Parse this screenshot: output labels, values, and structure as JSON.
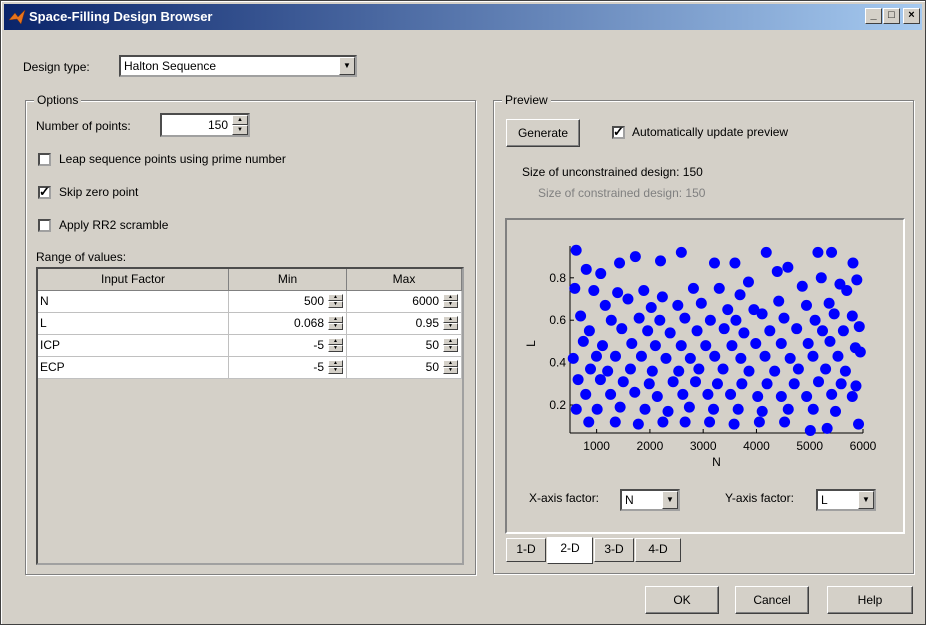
{
  "window": {
    "title": "Space-Filling Design Browser"
  },
  "design_type": {
    "label": "Design type:",
    "value": "Halton Sequence"
  },
  "options": {
    "legend": "Options",
    "num_points_label": "Number of points:",
    "num_points_value": "150",
    "leap_label": "Leap sequence points using prime number",
    "leap_checked": false,
    "skip_zero_label": "Skip zero point",
    "skip_zero_checked": true,
    "rr2_label": "Apply RR2 scramble",
    "rr2_checked": false,
    "range_label": "Range of values:",
    "table": {
      "columns": [
        "Input Factor",
        "Min",
        "Max"
      ],
      "rows": [
        {
          "factor": "N",
          "min": "500",
          "max": "6000"
        },
        {
          "factor": "L",
          "min": "0.068",
          "max": "0.95"
        },
        {
          "factor": "ICP",
          "min": "-5",
          "max": "50"
        },
        {
          "factor": "ECP",
          "min": "-5",
          "max": "50"
        }
      ]
    }
  },
  "preview": {
    "legend": "Preview",
    "generate_label": "Generate",
    "auto_update_label": "Automatically update preview",
    "auto_update_checked": true,
    "unconstrained_text": "Size of unconstrained design: 150",
    "constrained_text": "Size of constrained design: 150",
    "x_factor_label": "X-axis factor:",
    "x_factor_value": "N",
    "y_factor_label": "Y-axis factor:",
    "y_factor_value": "L",
    "tabs": [
      "1-D",
      "2-D",
      "3-D",
      "4-D"
    ],
    "active_tab": "2-D"
  },
  "buttons": {
    "ok": "OK",
    "cancel": "Cancel",
    "help": "Help"
  },
  "colors": {
    "titlebar": "#0a246a",
    "points": "#0000ff",
    "face": "#d4d0c8"
  },
  "chart_data": {
    "type": "scatter",
    "xlabel": "N",
    "ylabel": "L",
    "xlim": [
      500,
      6000
    ],
    "ylim": [
      0.068,
      0.95
    ],
    "xticks": [
      1000,
      2000,
      3000,
      4000,
      5000,
      6000
    ],
    "yticks": [
      0.2,
      0.4,
      0.6,
      0.8
    ],
    "series": [
      {
        "points": [
          [
            616,
            0.93
          ],
          [
            1077,
            0.82
          ],
          [
            805,
            0.84
          ],
          [
            1430,
            0.87
          ],
          [
            1727,
            0.9
          ],
          [
            2199,
            0.88
          ],
          [
            2590,
            0.92
          ],
          [
            3212,
            0.87
          ],
          [
            3596,
            0.87
          ],
          [
            4184,
            0.92
          ],
          [
            4590,
            0.85
          ],
          [
            5154,
            0.92
          ],
          [
            5410,
            0.92
          ],
          [
            5812,
            0.87
          ],
          [
            590,
            0.75
          ],
          [
            947,
            0.74
          ],
          [
            1394,
            0.73
          ],
          [
            1885,
            0.74
          ],
          [
            2234,
            0.71
          ],
          [
            2817,
            0.75
          ],
          [
            3302,
            0.75
          ],
          [
            3692,
            0.72
          ],
          [
            3850,
            0.78
          ],
          [
            4391,
            0.83
          ],
          [
            4860,
            0.76
          ],
          [
            5217,
            0.8
          ],
          [
            5567,
            0.77
          ],
          [
            5884,
            0.79
          ],
          [
            1162,
            0.67
          ],
          [
            1588,
            0.7
          ],
          [
            2025,
            0.66
          ],
          [
            2524,
            0.67
          ],
          [
            2965,
            0.68
          ],
          [
            3461,
            0.65
          ],
          [
            3952,
            0.65
          ],
          [
            4418,
            0.69
          ],
          [
            4939,
            0.67
          ],
          [
            5364,
            0.68
          ],
          [
            5695,
            0.74
          ],
          [
            699,
            0.62
          ],
          [
            1275,
            0.6
          ],
          [
            1798,
            0.61
          ],
          [
            2186,
            0.6
          ],
          [
            2656,
            0.61
          ],
          [
            3135,
            0.6
          ],
          [
            3615,
            0.6
          ],
          [
            4106,
            0.63
          ],
          [
            4517,
            0.61
          ],
          [
            5101,
            0.6
          ],
          [
            5459,
            0.63
          ],
          [
            5799,
            0.62
          ],
          [
            864,
            0.55
          ],
          [
            1472,
            0.56
          ],
          [
            1958,
            0.55
          ],
          [
            2380,
            0.54
          ],
          [
            2885,
            0.55
          ],
          [
            3394,
            0.56
          ],
          [
            3765,
            0.54
          ],
          [
            4251,
            0.55
          ],
          [
            4755,
            0.56
          ],
          [
            5240,
            0.55
          ],
          [
            5632,
            0.55
          ],
          [
            5930,
            0.57
          ],
          [
            750,
            0.5
          ],
          [
            1110,
            0.48
          ],
          [
            1660,
            0.49
          ],
          [
            2103,
            0.48
          ],
          [
            2588,
            0.48
          ],
          [
            3048,
            0.48
          ],
          [
            3540,
            0.48
          ],
          [
            3987,
            0.49
          ],
          [
            4466,
            0.49
          ],
          [
            4971,
            0.49
          ],
          [
            5380,
            0.5
          ],
          [
            5857,
            0.47
          ],
          [
            561,
            0.42
          ],
          [
            997,
            0.43
          ],
          [
            1354,
            0.43
          ],
          [
            1841,
            0.43
          ],
          [
            2302,
            0.42
          ],
          [
            2759,
            0.42
          ],
          [
            3217,
            0.43
          ],
          [
            3707,
            0.42
          ],
          [
            4161,
            0.43
          ],
          [
            4633,
            0.42
          ],
          [
            5061,
            0.43
          ],
          [
            5530,
            0.43
          ],
          [
            5950,
            0.45
          ],
          [
            885,
            0.37
          ],
          [
            1207,
            0.36
          ],
          [
            1635,
            0.37
          ],
          [
            2045,
            0.36
          ],
          [
            2541,
            0.36
          ],
          [
            2919,
            0.37
          ],
          [
            3373,
            0.37
          ],
          [
            3860,
            0.36
          ],
          [
            4342,
            0.36
          ],
          [
            4787,
            0.37
          ],
          [
            5298,
            0.37
          ],
          [
            5670,
            0.36
          ],
          [
            652,
            0.32
          ],
          [
            1071,
            0.32
          ],
          [
            1500,
            0.31
          ],
          [
            1988,
            0.3
          ],
          [
            2436,
            0.31
          ],
          [
            2856,
            0.31
          ],
          [
            3268,
            0.3
          ],
          [
            3726,
            0.3
          ],
          [
            4199,
            0.3
          ],
          [
            4709,
            0.3
          ],
          [
            5165,
            0.31
          ],
          [
            5590,
            0.3
          ],
          [
            5868,
            0.29
          ],
          [
            795,
            0.25
          ],
          [
            1262,
            0.25
          ],
          [
            1716,
            0.26
          ],
          [
            2139,
            0.24
          ],
          [
            2618,
            0.25
          ],
          [
            3089,
            0.25
          ],
          [
            3514,
            0.25
          ],
          [
            4024,
            0.24
          ],
          [
            4467,
            0.24
          ],
          [
            4942,
            0.24
          ],
          [
            5412,
            0.25
          ],
          [
            5799,
            0.24
          ],
          [
            618,
            0.18
          ],
          [
            1010,
            0.18
          ],
          [
            1441,
            0.19
          ],
          [
            1908,
            0.18
          ],
          [
            2340,
            0.17
          ],
          [
            2741,
            0.19
          ],
          [
            3194,
            0.18
          ],
          [
            3657,
            0.18
          ],
          [
            4108,
            0.17
          ],
          [
            4597,
            0.18
          ],
          [
            5066,
            0.18
          ],
          [
            5484,
            0.17
          ],
          [
            852,
            0.12
          ],
          [
            1350,
            0.12
          ],
          [
            1783,
            0.11
          ],
          [
            2244,
            0.12
          ],
          [
            2661,
            0.12
          ],
          [
            3120,
            0.12
          ],
          [
            3580,
            0.11
          ],
          [
            4055,
            0.12
          ],
          [
            4528,
            0.12
          ],
          [
            5011,
            0.08
          ],
          [
            5327,
            0.09
          ],
          [
            5916,
            0.11
          ]
        ]
      }
    ]
  }
}
